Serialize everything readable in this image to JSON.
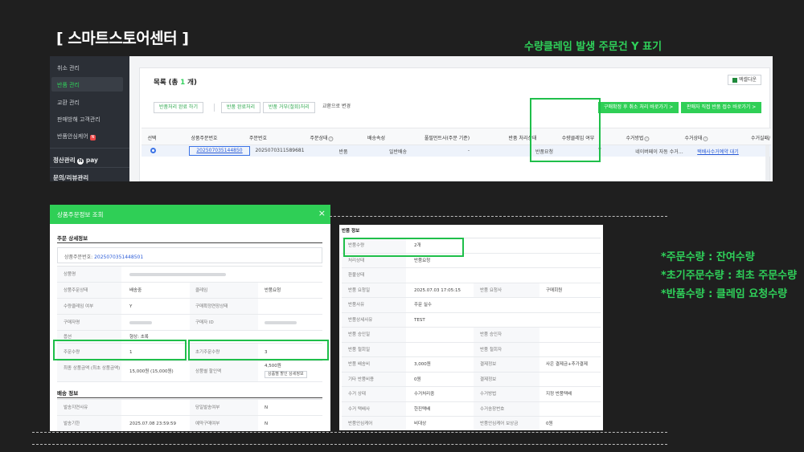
{
  "title": "[ 스마트스토어센터 ]",
  "callout_top": "수량클레임 발생 주문건 Y 표기",
  "notes": [
    "*주문수량 : 잔여수량",
    "*초기주문수량 : 최초 주문수량",
    "*반품수량 : 클레임 요청수량"
  ],
  "sidebar": {
    "items": [
      "취소 관리",
      "반품 관리",
      "교환 관리",
      "판매방해 고객관리",
      "반품안심케어"
    ],
    "sections": [
      "정산관리",
      "문의/리뷰관리"
    ],
    "npay": "pay",
    "new_badge": "N"
  },
  "list": {
    "title_prefix": "목록 (총 ",
    "count": "1",
    "title_suffix": " 개)",
    "excel": "엑셀다운"
  },
  "toolbar": {
    "btn1": "반품처리 완료 하기",
    "btn2": "반품 완료처리",
    "btn3": "반품 거부(철회)처리",
    "btn4": "교환으로 변경",
    "btn5": "구매확정 후 취소 처리 바로가기 >",
    "btn6": "판매자 직접 반품 접수 바로가기 >"
  },
  "table": {
    "headers": [
      "선택",
      "상품주문번호",
      "주문번호",
      "주문상태",
      "배송속성",
      "풀필먼트사(주문 기준)",
      "반품 처리상태",
      "수량클레임 여부",
      "수거방법",
      "수거상태",
      "수거실패/"
    ],
    "row": [
      "202507035144850",
      "2025070311589681",
      "반품",
      "일반배송",
      "-",
      "반품요청",
      "Y",
      "네이버페이 자동 수거…",
      "택배사수거예약 대기"
    ]
  },
  "modal": {
    "title": "상품주문정보 조회",
    "close": "×",
    "sec1": "주문 상세정보",
    "order_no_label": "상품주문번호: ",
    "order_no": "2025070351448501",
    "rows": [
      {
        "l1": "상품명",
        "v1": ""
      },
      {
        "l1": "상품주문상태",
        "v1": "배송중",
        "l2": "클레임",
        "v2": "반품요청"
      },
      {
        "l1": "수량클레임 여부",
        "v1": "Y",
        "l2": "구매확정연장상태",
        "v2": ""
      },
      {
        "l1": "구매자명",
        "v1": "",
        "l2": "구매자 ID",
        "v2": ""
      },
      {
        "l1": "옵션",
        "v1": "형상: 초록"
      },
      {
        "l1": "주문수량",
        "v1": "1",
        "l2": "초기주문수량",
        "v2": "3"
      },
      {
        "l1": "최종 상품금액 (최초 상품금액)",
        "v1": "15,000원 (15,000원)",
        "l2": "상품별 할인액",
        "v2": "4,500원",
        "btn": "상품별 할인 상세정보"
      }
    ],
    "sec2": "배송 정보",
    "ship_rows": [
      {
        "l1": "발송지연사유",
        "v1": "",
        "l2": "당일발송여부",
        "v2": "N"
      },
      {
        "l1": "발송기한",
        "v1": "2025.07.08 23:59:59",
        "l2": "예약구매여부",
        "v2": "N"
      }
    ]
  },
  "claim": {
    "title": "반품 정보",
    "rows": [
      {
        "l1": "반품수량",
        "v1": "2개"
      },
      {
        "l1": "처리상태",
        "v1": "반품요청"
      },
      {
        "l1": "환불상태",
        "v1": ""
      },
      {
        "l1": "반품 요청일",
        "v1": "2025.07.03 17:05:15",
        "l2": "반품 요청사",
        "v2": "구매회원"
      },
      {
        "l1": "반품사유",
        "v1": "주문 실수"
      },
      {
        "l1": "반품상세사유",
        "v1": "TEST"
      },
      {
        "l1": "반품 승인일",
        "v1": "",
        "l2": "반품 승인자",
        "v2": ""
      },
      {
        "l1": "반품 철회일",
        "v1": "",
        "l2": "반품 철회자",
        "v2": ""
      },
      {
        "l1": "반품 배송비",
        "v1": "3,000원",
        "l2": "결제정보",
        "v2": "사은 결제금+추가결제"
      },
      {
        "l1": "기타 반품비용",
        "v1": "0원",
        "l2": "결제정보",
        "v2": ""
      },
      {
        "l1": "수거 상태",
        "v1": "수거처리중",
        "l2": "수거방법",
        "v2": "지정 반품택배"
      },
      {
        "l1": "수거 택배사",
        "v1": "한진택배",
        "l2": "수거송장번호",
        "v2": ""
      },
      {
        "l1": "반품안심케어",
        "v1": "비대상",
        "l2": "반품안심케어 보상금",
        "v2": "0원"
      }
    ]
  }
}
